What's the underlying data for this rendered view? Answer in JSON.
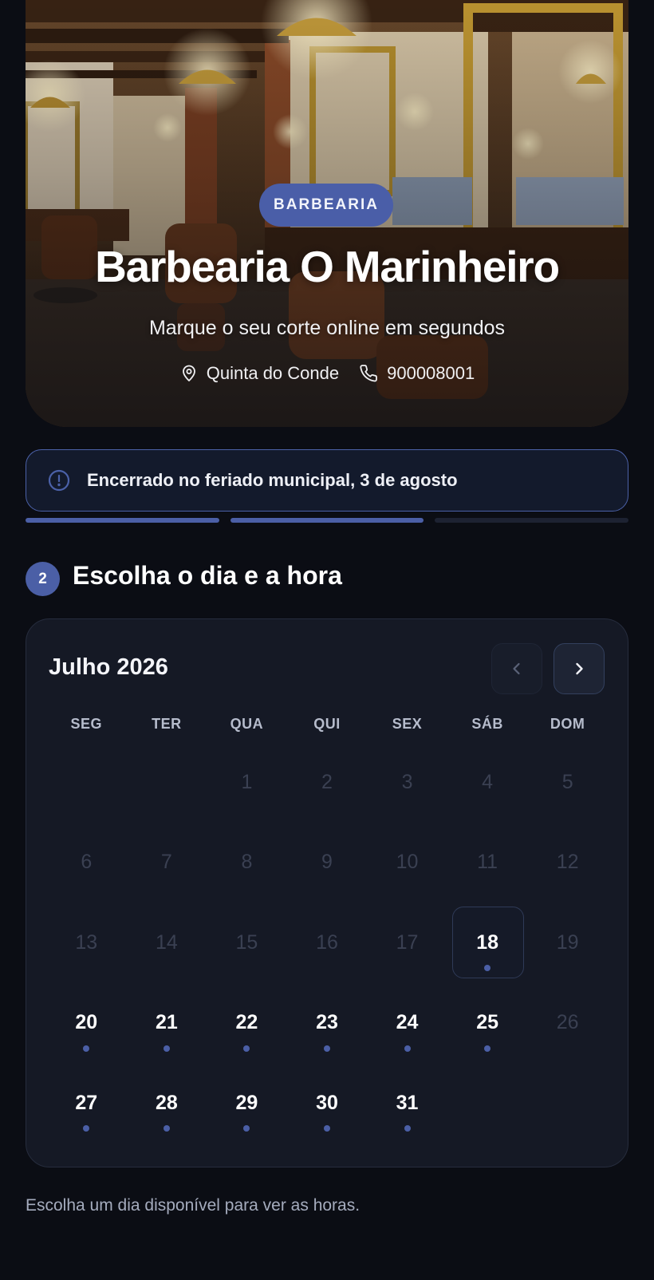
{
  "hero": {
    "badge": "BARBEARIA",
    "title": "Barbearia O Marinheiro",
    "subtitle": "Marque o seu corte online em segundos",
    "location": "Quinta do Conde",
    "phone": "900008001",
    "location_icon": "map-pin-icon",
    "phone_icon": "phone-icon"
  },
  "notice": {
    "icon": "info-icon",
    "text": "Encerrado no feriado municipal, 3 de agosto"
  },
  "progress": {
    "total_steps": 3,
    "completed_steps": 2
  },
  "step": {
    "number": "2",
    "title": "Escolha o dia e a hora"
  },
  "calendar": {
    "month_label": "Julho 2026",
    "prev_icon": "chevron-left-icon",
    "next_icon": "chevron-right-icon",
    "weekdays": [
      "SEG",
      "TER",
      "QUA",
      "QUI",
      "SEX",
      "SÁB",
      "DOM"
    ],
    "leading_blanks": 2,
    "days": [
      {
        "n": "1",
        "available": false
      },
      {
        "n": "2",
        "available": false
      },
      {
        "n": "3",
        "available": false
      },
      {
        "n": "4",
        "available": false
      },
      {
        "n": "5",
        "available": false
      },
      {
        "n": "6",
        "available": false
      },
      {
        "n": "7",
        "available": false
      },
      {
        "n": "8",
        "available": false
      },
      {
        "n": "9",
        "available": false
      },
      {
        "n": "10",
        "available": false
      },
      {
        "n": "11",
        "available": false
      },
      {
        "n": "12",
        "available": false
      },
      {
        "n": "13",
        "available": false
      },
      {
        "n": "14",
        "available": false
      },
      {
        "n": "15",
        "available": false
      },
      {
        "n": "16",
        "available": false
      },
      {
        "n": "17",
        "available": false
      },
      {
        "n": "18",
        "available": true,
        "today": true
      },
      {
        "n": "19",
        "available": false
      },
      {
        "n": "20",
        "available": true
      },
      {
        "n": "21",
        "available": true
      },
      {
        "n": "22",
        "available": true
      },
      {
        "n": "23",
        "available": true
      },
      {
        "n": "24",
        "available": true
      },
      {
        "n": "25",
        "available": true
      },
      {
        "n": "26",
        "available": false
      },
      {
        "n": "27",
        "available": true
      },
      {
        "n": "28",
        "available": true
      },
      {
        "n": "29",
        "available": true
      },
      {
        "n": "30",
        "available": true
      },
      {
        "n": "31",
        "available": true
      }
    ]
  },
  "hint": "Escolha um dia disponível para ver as horas.",
  "colors": {
    "accent": "#4b5fa6",
    "background": "#0b0d14",
    "card": "#151925"
  }
}
